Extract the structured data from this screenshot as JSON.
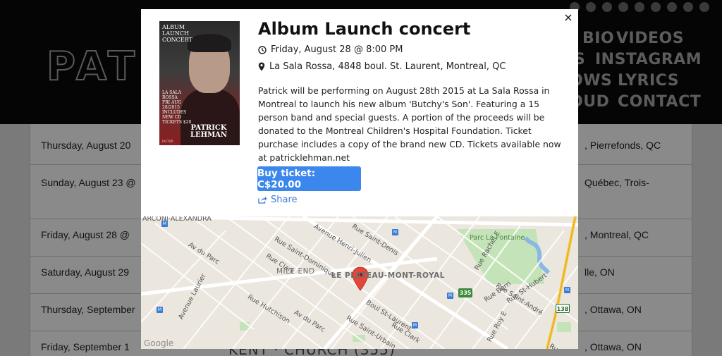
{
  "site": {
    "logo_text": "PATI",
    "social_icons": [
      "cd-icon",
      "facebook-icon",
      "twitter-icon",
      "instagram-icon",
      "youtube-icon",
      "web-icon",
      "amazon-icon",
      "soundcloud-icon",
      "spotify-icon"
    ],
    "nav": [
      "BIO",
      "VIDEOS",
      "S",
      "INSTAGRAM",
      "OWS",
      "LYRICS",
      "OUD",
      "CONTACT"
    ],
    "events": [
      {
        "date": "Thursday, August 20",
        "location": ", Pierrefonds, QC"
      },
      {
        "date": "Sunday, August 23 @",
        "location": "Québec, Trois-"
      },
      {
        "date": "Friday, August 28 @",
        "location": ", Montreal, QC"
      },
      {
        "date": "Saturday, August 29",
        "location": "lle, ON"
      },
      {
        "date": "Thursday, September",
        "location": ", Ottawa, ON"
      },
      {
        "date": "Friday, September 1",
        "location": ", Ottawa, ON"
      }
    ],
    "ghost_text": "KENT · CHURCH (355)"
  },
  "modal": {
    "title": "Album Launch concert",
    "datetime": "Friday, August 28 @ 8:00 PM",
    "venue": "La Sala Rossa, 4848 boul. St. Laurent, Montreal, QC",
    "description": "Patrick will be performing on August 28th 2015 at La Sala Rossa in Montreal to launch his new album 'Butchy's Son'. Featuring a 15 person band and special guests. A portion of the proceeds will be donated to the Montreal Children's Hospital Foundation. Ticket purchase includes a copy of the brand new CD. Tickets available now at patricklehman.net",
    "buy_label": "Buy ticket: C$20.00",
    "share_label": "Share",
    "close_glyph": "×",
    "poster": {
      "header": [
        "ALBUM",
        "LAUNCH",
        "CONCERT"
      ],
      "info": [
        "LA SALA",
        "ROSSA",
        "FRI AUG",
        "28/2015",
        "INCLUDES",
        "NEW CD",
        "TICKETS $20"
      ],
      "name": [
        "PATRICK",
        "LEHMAN"
      ],
      "footer": "FACTOR"
    },
    "accent_color": "#3b87ee",
    "share_color": "#3a7bd5"
  },
  "map": {
    "district": "LE PLATEAU-MONT-ROYAL",
    "neighbourhood": "MILE END",
    "park": "Parc La Fontaine",
    "streets": [
      "ARCONI-ALEXANDRA",
      "Avenue Henri-Julien",
      "Rue Saint-Denis",
      "Rue Saint-Dominique",
      "Rue Clark",
      "Av du Parc",
      "Avenue Laurier",
      "Rue Hutchison",
      "Av du Parc",
      "Boul St-Laurent",
      "Rue Clark",
      "Rue Saint-Urbain",
      "Rue Rachel E",
      "Rue Saint-André",
      "Rue St-Hubert",
      "Rue Berri",
      "Rue Roy E",
      "Rue Boyer"
    ],
    "shields": [
      "335",
      "138"
    ],
    "brand": "Google"
  }
}
